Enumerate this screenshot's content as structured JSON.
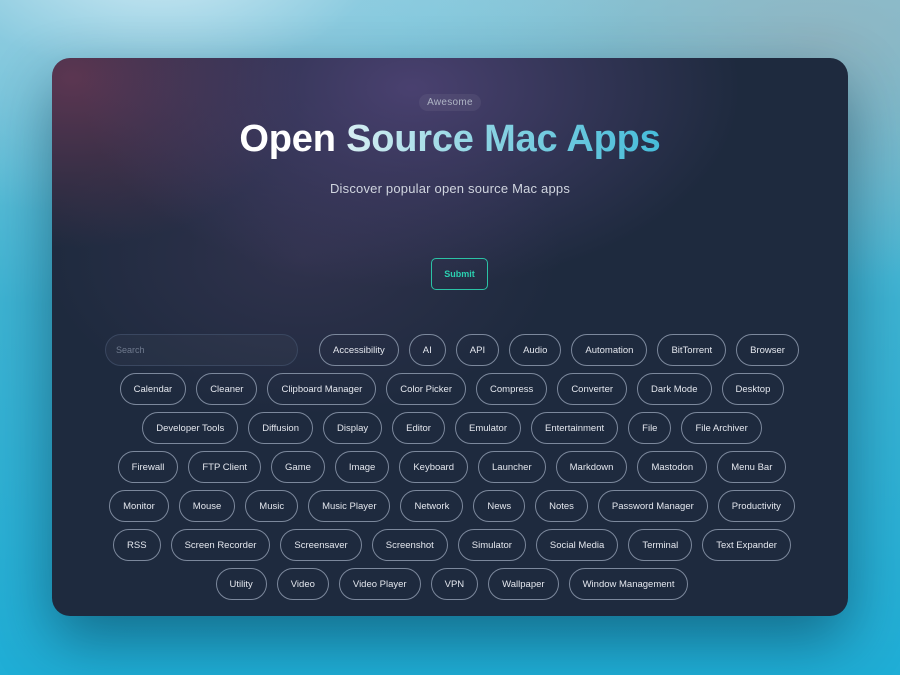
{
  "hero": {
    "eyebrow": "Awesome",
    "title_part1": "Open",
    "title_part2": "Source Mac Apps",
    "subtitle": "Discover popular open source Mac apps",
    "submit_label": "Submit"
  },
  "search": {
    "placeholder": "Search",
    "value": ""
  },
  "colors": {
    "accent": "#2bc2a5",
    "card_background": "#1e2a3e",
    "title_gradient_end": "#46bcd9"
  },
  "tag_rows": [
    [
      "Accessibility",
      "AI",
      "API",
      "Audio",
      "Automation",
      "BitTorrent",
      "Browser"
    ],
    [
      "Calendar",
      "Cleaner",
      "Clipboard Manager",
      "Color Picker",
      "Compress",
      "Converter",
      "Dark Mode",
      "Desktop"
    ],
    [
      "Developer Tools",
      "Diffusion",
      "Display",
      "Editor",
      "Emulator",
      "Entertainment",
      "File",
      "File Archiver"
    ],
    [
      "Firewall",
      "FTP Client",
      "Game",
      "Image",
      "Keyboard",
      "Launcher",
      "Markdown",
      "Mastodon",
      "Menu Bar"
    ],
    [
      "Monitor",
      "Mouse",
      "Music",
      "Music Player",
      "Network",
      "News",
      "Notes",
      "Password Manager",
      "Productivity"
    ],
    [
      "RSS",
      "Screen Recorder",
      "Screensaver",
      "Screenshot",
      "Simulator",
      "Social Media",
      "Terminal",
      "Text Expander"
    ],
    [
      "Utility",
      "Video",
      "Video Player",
      "VPN",
      "Wallpaper",
      "Window Management"
    ]
  ]
}
